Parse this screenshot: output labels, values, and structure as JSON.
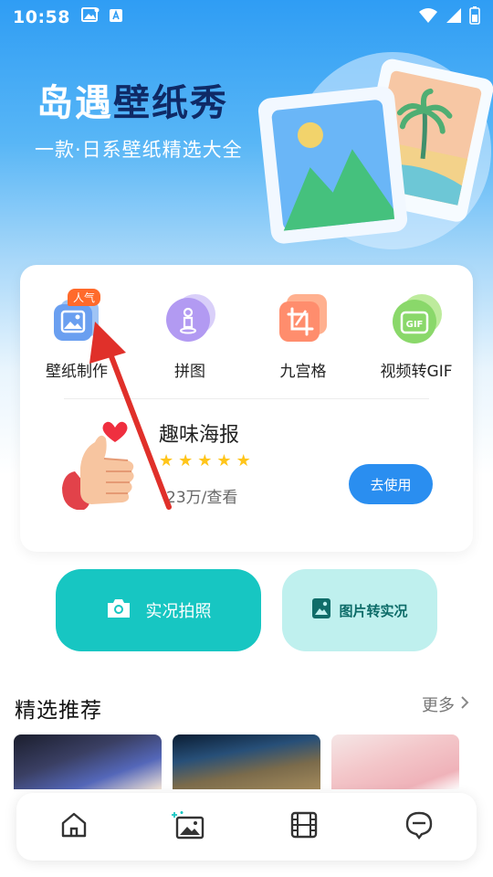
{
  "status_bar": {
    "time": "10:58"
  },
  "hero": {
    "title_part1": "岛遇",
    "title_part2": "壁纸秀",
    "subtitle": "一款·日系壁纸精选大全"
  },
  "tools": [
    {
      "label": "壁纸制作",
      "badge": "人气",
      "icon": "wallpaper-make-icon"
    },
    {
      "label": "拼图",
      "icon": "puzzle-icon"
    },
    {
      "label": "九宫格",
      "icon": "crop-grid-icon"
    },
    {
      "label": "视频转GIF",
      "icon": "gif-icon"
    }
  ],
  "promo": {
    "title": "趣味海报",
    "rating": 5,
    "views": "23万/查看",
    "button_label": "去使用"
  },
  "actions": {
    "live_photo_label": "实况拍照",
    "convert_label": "图片转实况"
  },
  "featured": {
    "title": "精选推荐",
    "more_label": "更多"
  },
  "bottom_nav": [
    {
      "icon": "home-icon"
    },
    {
      "icon": "wallpaper-icon"
    },
    {
      "icon": "film-icon"
    },
    {
      "icon": "chat-face-icon"
    }
  ],
  "colors": {
    "primary_blue": "#2a8ef0",
    "teal": "#17c6c2",
    "teal_light": "#bff0ee",
    "title_dark": "#0f2a66",
    "badge_orange": "#ff6a2b",
    "arrow_red": "#e0302a"
  }
}
